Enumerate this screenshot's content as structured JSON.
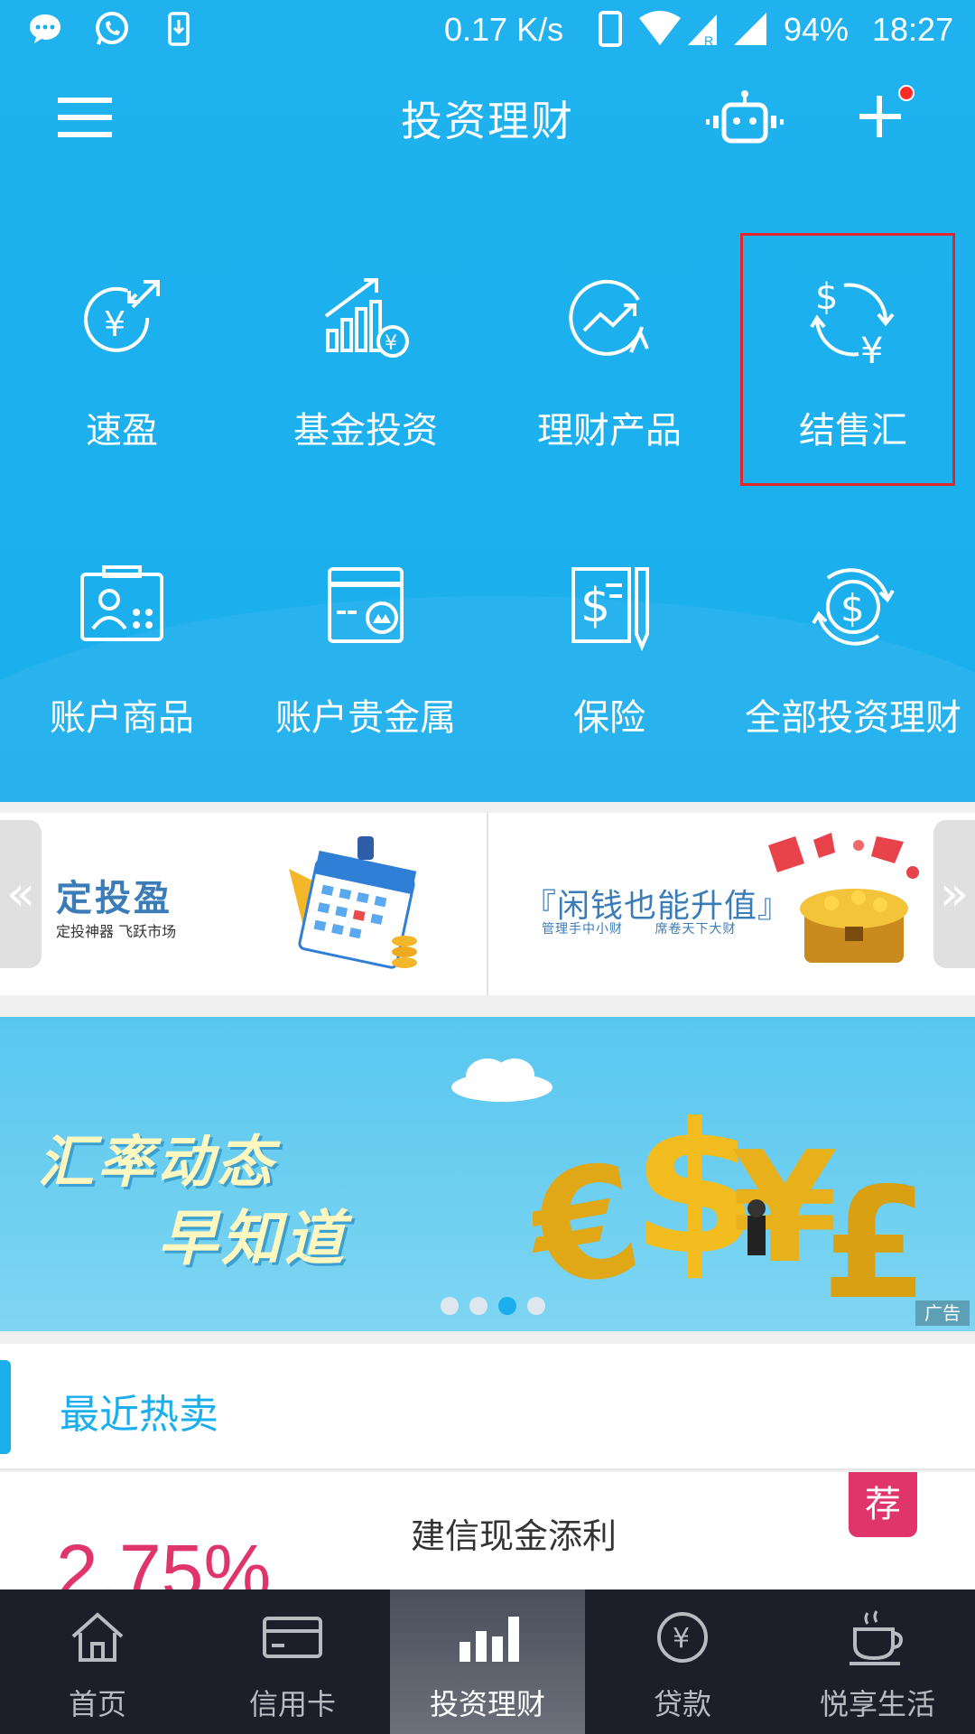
{
  "status_bar": {
    "speed": "0.17 K/s",
    "battery": "94%",
    "time": "18:27"
  },
  "header": {
    "title": "投资理财"
  },
  "grid": {
    "items": [
      {
        "label": "速盈",
        "icon": "yen-exchange-icon"
      },
      {
        "label": "基金投资",
        "icon": "fund-growth-icon"
      },
      {
        "label": "理财产品",
        "icon": "trend-circle-icon"
      },
      {
        "label": "结售汇",
        "icon": "currency-exchange-icon"
      },
      {
        "label": "账户商品",
        "icon": "account-commodity-icon"
      },
      {
        "label": "账户贵金属",
        "icon": "precious-metal-icon"
      },
      {
        "label": "保险",
        "icon": "insurance-icon"
      },
      {
        "label": "全部投资理财",
        "icon": "all-investment-icon"
      }
    ]
  },
  "promos": {
    "left": {
      "title": "定投盈",
      "subtitle": "定投神器  飞跃市场"
    },
    "right": {
      "title": "『闲钱也能升值』",
      "subtitle": "管理手中小财 席卷天下大财"
    }
  },
  "banner": {
    "line1": "汇率动态",
    "line2": "早知道",
    "ad_label": "广告",
    "page_count": 4,
    "active_page": 3
  },
  "hot_sales": {
    "title": "最近热卖",
    "product": {
      "name": "建信现金添利",
      "rate": "2.75%",
      "badge": "荐"
    }
  },
  "bottom_nav": {
    "items": [
      {
        "label": "首页",
        "icon": "home-icon"
      },
      {
        "label": "信用卡",
        "icon": "credit-card-icon"
      },
      {
        "label": "投资理财",
        "icon": "bar-chart-icon",
        "active": true
      },
      {
        "label": "贷款",
        "icon": "yen-coin-icon"
      },
      {
        "label": "悦享生活",
        "icon": "coffee-cup-icon"
      }
    ]
  },
  "colors": {
    "header_blue": "#1aaeed",
    "accent_pink": "#e0356b",
    "highlight_red": "#e0262a",
    "nav_dark": "#1c1f2a"
  }
}
